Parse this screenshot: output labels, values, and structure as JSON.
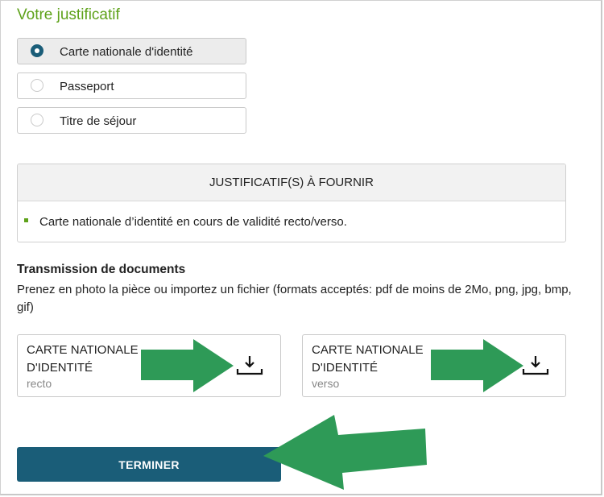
{
  "section": {
    "title": "Votre justificatif"
  },
  "document_type": {
    "selected": "Carte nationale d'identité",
    "options": [
      {
        "label": "Carte nationale d'identité",
        "checked": true
      },
      {
        "label": "Passeport",
        "checked": false
      },
      {
        "label": "Titre de séjour",
        "checked": false
      }
    ]
  },
  "requirements": {
    "header": "JUSTIFICATIF(S) À FOURNIR",
    "items": [
      "Carte nationale d’identité en cours de validité recto/verso."
    ]
  },
  "transmission": {
    "title": "Transmission de documents",
    "description": "Prenez en photo la pièce ou importez un fichier (formats acceptés: pdf de moins de 2Mo, png, jpg, bmp, gif)"
  },
  "uploads": [
    {
      "name": "CARTE NATIONALE D'IDENTITÉ",
      "side": "recto",
      "icon": "download-icon"
    },
    {
      "name": "CARTE NATIONALE D'IDENTITÉ",
      "side": "verso",
      "icon": "download-icon"
    }
  ],
  "actions": {
    "finish_label": "TERMINER"
  },
  "colors": {
    "accent_green": "#5ea21a",
    "primary_button": "#1a5d78",
    "annotation_arrow": "#2e9a57"
  }
}
